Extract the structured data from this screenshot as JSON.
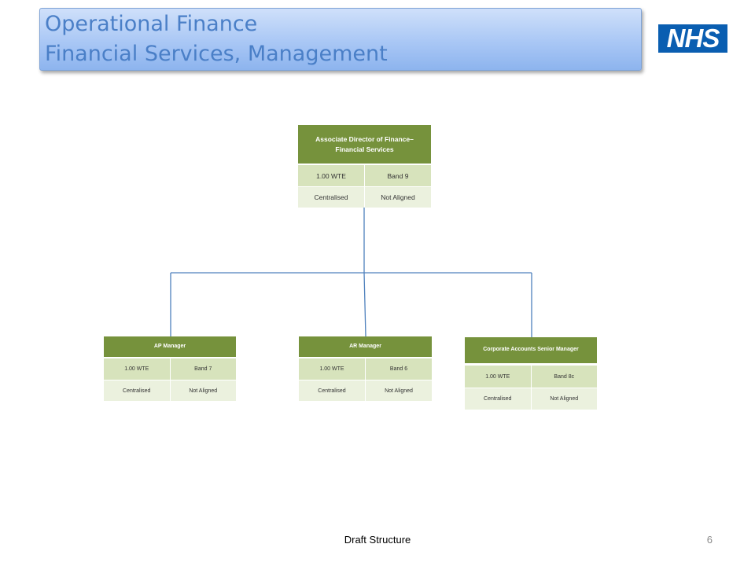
{
  "header": {
    "title_line1": "Operational Finance",
    "title_line2": "Financial Services, Management",
    "logo_text": "NHS"
  },
  "org_chart": {
    "root": {
      "title": "Associate Director of Finance– Financial Services",
      "wte": "1.00 WTE",
      "band": "Band 9",
      "status": "Centralised",
      "alignment": "Not Aligned"
    },
    "children": [
      {
        "title": "AP Manager",
        "wte": "1.00 WTE",
        "band": "Band 7",
        "status": "Centralised",
        "alignment": "Not Aligned"
      },
      {
        "title": "AR Manager",
        "wte": "1.00 WTE",
        "band": "Band 6",
        "status": "Centralised",
        "alignment": "Not Aligned"
      },
      {
        "title": "Corporate Accounts Senior Manager",
        "wte": "1.00 WTE",
        "band": "Band 8c",
        "status": "Centralised",
        "alignment": "Not Aligned"
      }
    ]
  },
  "footer": {
    "label": "Draft Structure",
    "page_number": "6"
  },
  "colors": {
    "card_header": "#76923c",
    "row_dark": "#d7e3bc",
    "row_light": "#ebf1de",
    "connector": "#4f81bd",
    "title_text": "#4a7fc7",
    "nhs_blue": "#0a5eb1"
  }
}
